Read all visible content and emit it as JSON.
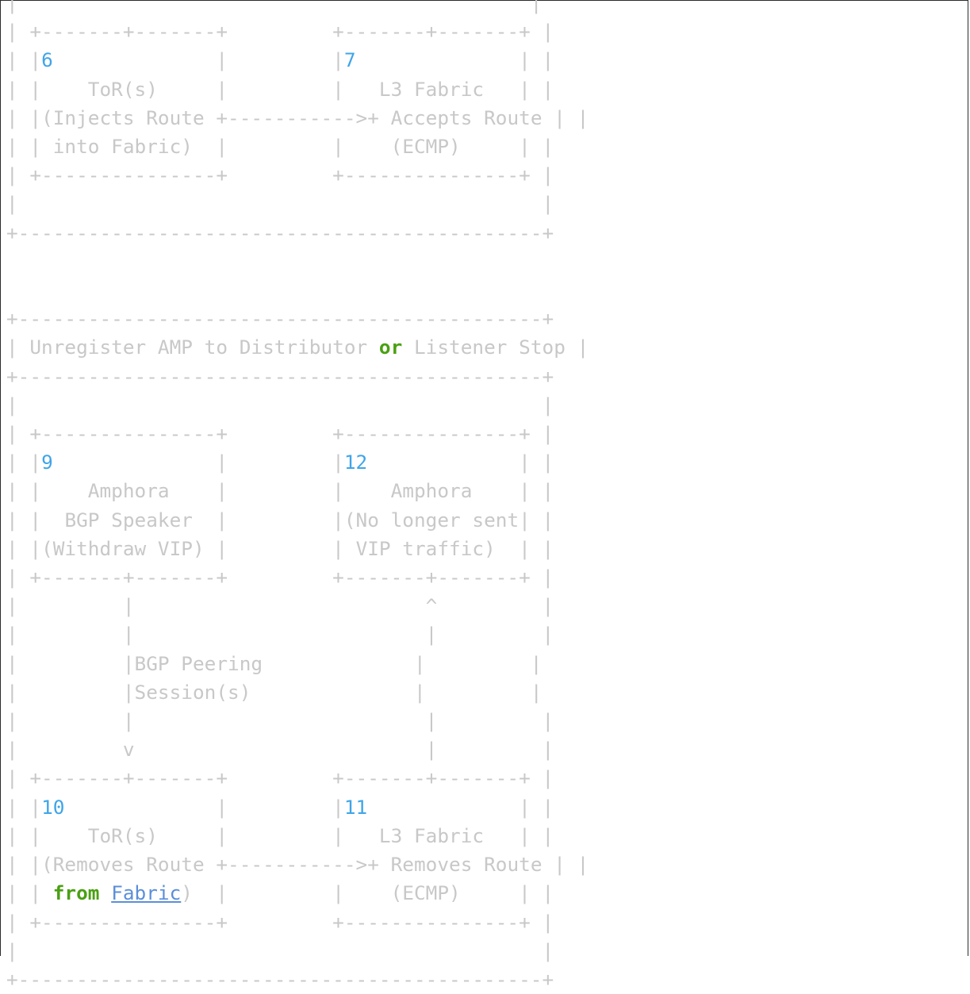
{
  "diagram": {
    "section1": {
      "node6": {
        "number": "6",
        "line1": "ToR(s)",
        "line2": "(Injects Route",
        "line3": "into Fabric)"
      },
      "node7": {
        "number": "7",
        "line1": "L3 Fabric",
        "line2": "Accepts Route",
        "line3": "(ECMP)"
      }
    },
    "section2": {
      "header_pre": "Unregister AMP to Distributor ",
      "header_or": "or",
      "header_post": " Listener Stop",
      "node9": {
        "number": "9",
        "line1": "Amphora",
        "line2": "BGP Speaker",
        "line3": "(Withdraw VIP)"
      },
      "node12": {
        "number": "12",
        "line1": "Amphora",
        "line2": "(No longer sent",
        "line3": "VIP traffic)"
      },
      "peering_label1": "BGP Peering",
      "peering_label2": "Session(s)",
      "node10": {
        "number": "10",
        "line1": "ToR(s)",
        "line2": "(Removes Route",
        "line3_from": "from",
        "line3_fabric": "Fabric",
        "line3_end": ")"
      },
      "node11": {
        "number": "11",
        "line1": "L3 Fabric",
        "line2": "Removes Route",
        "line3": "(ECMP)"
      }
    }
  }
}
